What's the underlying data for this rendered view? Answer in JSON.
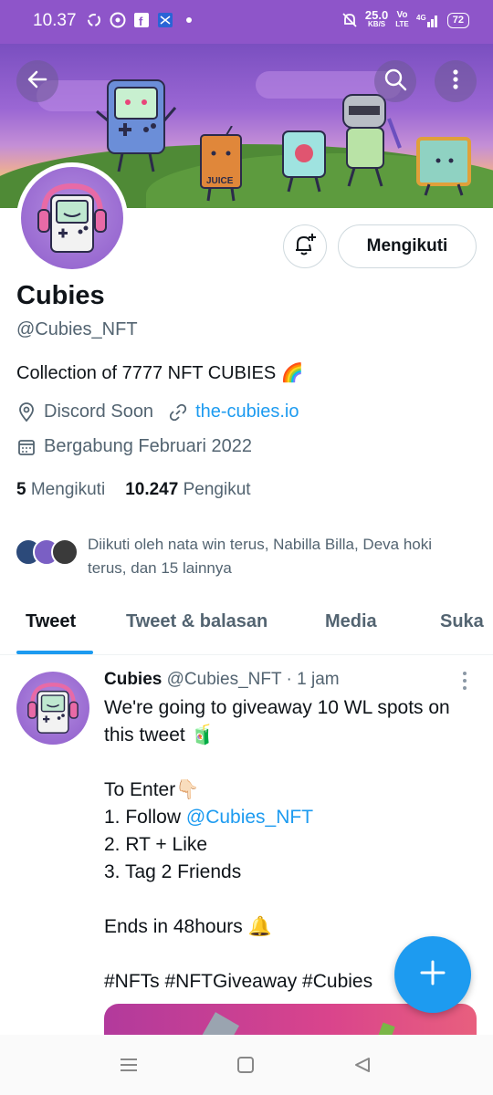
{
  "status_bar": {
    "time": "10.37",
    "net_speed_value": "25.0",
    "net_speed_unit": "KB/S",
    "network_top": "Vo",
    "network_bottom": "LTE",
    "signal": "⁴⁶",
    "battery": "72"
  },
  "profile": {
    "name": "Cubies",
    "handle": "@Cubies_NFT",
    "bio": "Collection of 7777 NFT CUBIES 🌈",
    "location": "Discord Soon",
    "website": "the-cubies.io",
    "joined": "Bergabung Februari 2022",
    "following_count": "5",
    "following_label": "Mengikuti",
    "followers_count": "10.247",
    "followers_label": "Pengikut",
    "followed_by": "Diikuti oleh nata win terus, Nabilla Billa, Deva hoki terus, dan 15 lainnya",
    "follow_button": "Mengikuti"
  },
  "banner": {
    "juice_label": "JUICE"
  },
  "tabs": [
    {
      "label": "Tweet",
      "active": true
    },
    {
      "label": "Tweet & balasan",
      "active": false
    },
    {
      "label": "Media",
      "active": false
    },
    {
      "label": "Suka",
      "active": false
    }
  ],
  "tweet": {
    "author": "Cubies",
    "handle": "@Cubies_NFT",
    "time": "· 1 jam",
    "lines": {
      "l1": "We're going to giveaway 10 WL spots on",
      "l2": "this tweet 🧃",
      "l3": "To Enter👇🏻",
      "l4_prefix": "1. Follow ",
      "l4_mention": "@Cubies_NFT",
      "l5": "2. RT + Like",
      "l6": "3. Tag 2 Friends",
      "l7": "Ends in 48hours 🔔",
      "l8": "#NFTs #NFTGiveaway #Cubies"
    }
  },
  "colors": {
    "accent": "#1d9bf0",
    "status_bar": "#8e55c9"
  },
  "icons": {
    "back": "back-arrow-icon",
    "search": "search-icon",
    "more": "more-vertical-icon",
    "notify": "bell-plus-icon",
    "location": "location-pin-icon",
    "link": "link-icon",
    "calendar": "calendar-icon",
    "compose": "plus-icon"
  }
}
